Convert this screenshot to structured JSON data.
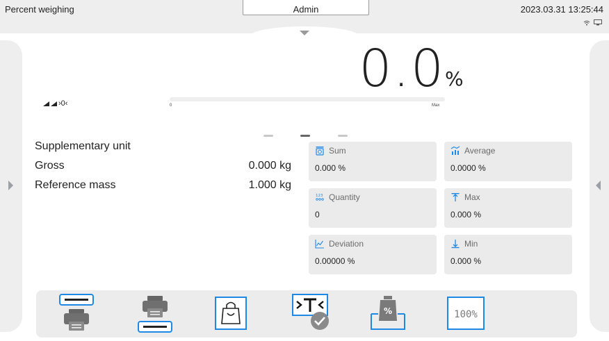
{
  "topbar": {
    "mode": "Percent weighing",
    "user": "Admin",
    "datetime": "2023.03.31 13:25:44",
    "icons": [
      "wifi-icon",
      "display-icon"
    ]
  },
  "reading": {
    "value": "0.0",
    "unit": "%",
    "status_text": "›0‹",
    "bargraph_min": "0",
    "bargraph_max": "Max"
  },
  "pages": {
    "count": 3,
    "active_index": 1
  },
  "info": [
    {
      "label": "Supplementary unit",
      "value": ""
    },
    {
      "label": "Gross",
      "value": "0.000 kg"
    },
    {
      "label": "Reference mass",
      "value": "1.000 kg"
    }
  ],
  "stats": [
    {
      "label": "Sum",
      "value": "0.000 %",
      "icon": "sum-icon"
    },
    {
      "label": "Average",
      "value": "0.0000 %",
      "icon": "average-icon"
    },
    {
      "label": "Quantity",
      "value": "0",
      "icon": "quantity-icon"
    },
    {
      "label": "Max",
      "value": "0.000 %",
      "icon": "max-icon"
    },
    {
      "label": "Deviation",
      "value": "0.00000 %",
      "icon": "deviation-icon"
    },
    {
      "label": "Min",
      "value": "0.000 %",
      "icon": "min-icon"
    }
  ],
  "toolbar": {
    "buttons": [
      "header-print-icon",
      "footer-print-icon",
      "bag-icon",
      "tare-icon",
      "reference-mass-icon",
      "percent-100-icon"
    ],
    "percent_label": "100%",
    "reference_label": "%"
  },
  "colors": {
    "accent": "#1e88e5",
    "tile_bg": "#ebebeb",
    "panel_bg": "#eeeeee"
  }
}
